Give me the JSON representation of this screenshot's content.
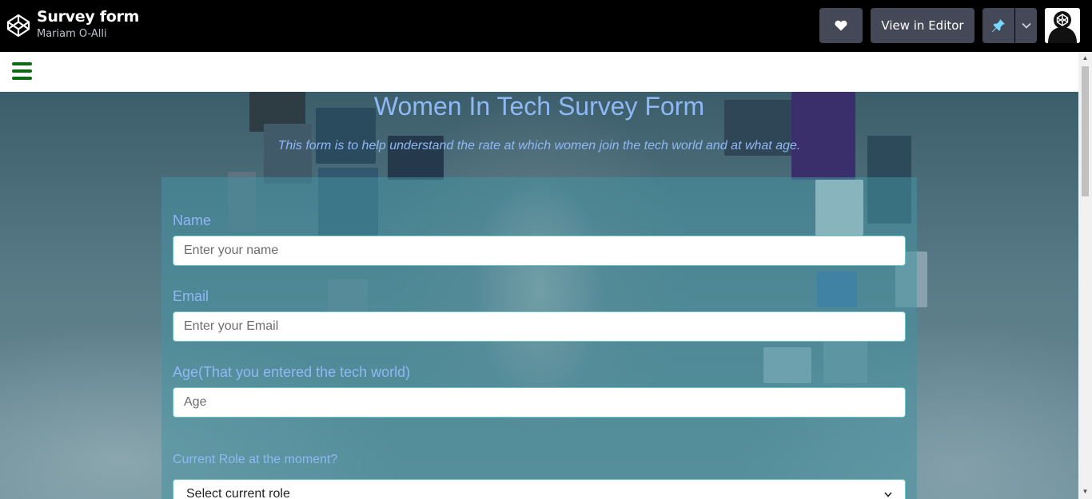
{
  "header": {
    "pen_title": "Survey form",
    "author": "Mariam O-Alli",
    "view_in_editor_label": "View in Editor",
    "heart_icon": "heart-icon",
    "pin_icon": "pin-icon",
    "dropdown_icon": "chevron-down-icon",
    "logo_icon": "codepen-logo-icon"
  },
  "form": {
    "title": "Women In Tech Survey Form",
    "description": "This form is to help understand the rate at which women join the tech world and at what age.",
    "name_label": "Name",
    "name_placeholder": "Enter your name",
    "email_label": "Email",
    "email_placeholder": "Enter your Email",
    "age_label": "Age(That you entered the tech world)",
    "age_placeholder": "Age",
    "role_label": "Current Role at the moment?",
    "role_selected": "Select current role"
  },
  "colors": {
    "heading": "#8fb8f5",
    "hamburger": "#0b6b12",
    "button_bg": "#444857"
  }
}
